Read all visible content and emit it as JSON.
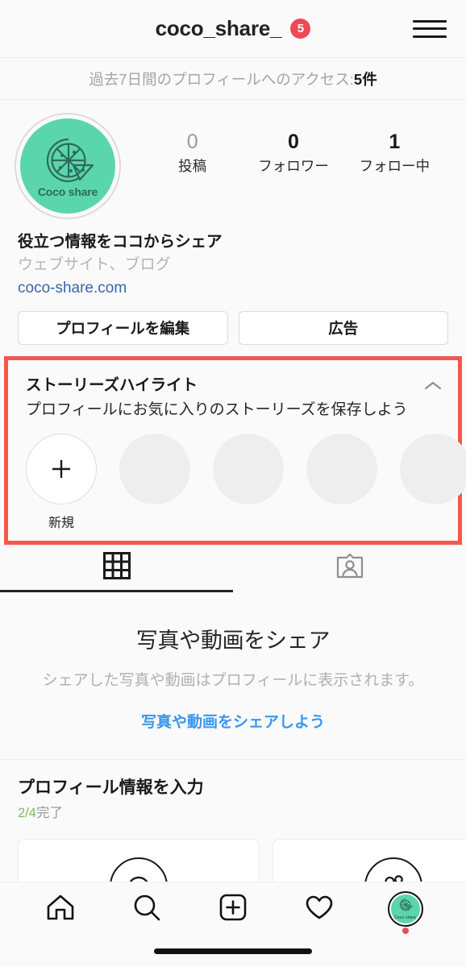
{
  "header": {
    "title": "coco_share_",
    "badge_count": "5",
    "menu_icon": "hamburger-icon",
    "badge_color": "#ED4956"
  },
  "insights": {
    "prefix": "過去7日間のプロフィールへのアクセス: ",
    "value": "5件"
  },
  "profile": {
    "avatar": {
      "label": "Coco share",
      "icon": "pizza-icon",
      "background_color": "#5BD6AC",
      "ink_color": "#2c6b5b"
    },
    "stats": [
      {
        "value": "0",
        "label": "投稿",
        "muted": true
      },
      {
        "value": "0",
        "label": "フォロワー",
        "muted": false
      },
      {
        "value": "1",
        "label": "フォロー中",
        "muted": false
      }
    ],
    "bio_name": "役立つ情報をココからシェア",
    "bio_category": "ウェブサイト、ブログ",
    "bio_link": "coco-share.com",
    "bio_link_color": "#3a64a8",
    "actions": [
      {
        "label": "プロフィールを編集"
      },
      {
        "label": "広告"
      }
    ]
  },
  "highlights": {
    "title": "ストーリーズハイライト",
    "subtitle": "プロフィールにお気に入りのストーリーズを保存しよう",
    "collapse_icon": "chevron-up-icon",
    "new_label": "新規",
    "new_icon": "plus-icon",
    "placeholder_count": 4,
    "annotation_color": "#F4584C"
  },
  "tabs": [
    {
      "name": "grid",
      "icon": "grid-icon",
      "active": true
    },
    {
      "name": "tagged",
      "icon": "tagged-person-icon",
      "active": false
    }
  ],
  "empty_state": {
    "title": "写真や動画をシェア",
    "subtitle": "シェアした写真や動画はプロフィールに表示されます。",
    "cta": "写真や動画をシェアしよう",
    "cta_color": "#3897f0"
  },
  "profile_completion": {
    "title": "プロフィール情報を入力",
    "progress_value": "2/4",
    "progress_suffix": "完了",
    "progress_color": "#7CBF5B",
    "cards": [
      {
        "icon": "speech-bubble-circle-icon"
      },
      {
        "icon": "people-circle-icon"
      }
    ]
  },
  "bottom_nav": [
    {
      "name": "home",
      "icon": "home-icon",
      "active": false
    },
    {
      "name": "search",
      "icon": "search-icon",
      "active": false
    },
    {
      "name": "create",
      "icon": "plus-square-icon",
      "active": false
    },
    {
      "name": "activity",
      "icon": "heart-icon",
      "active": false
    },
    {
      "name": "profile",
      "icon": "profile-avatar-icon",
      "active": true,
      "avatar_label": "Coco share",
      "has_dot": true
    }
  ]
}
